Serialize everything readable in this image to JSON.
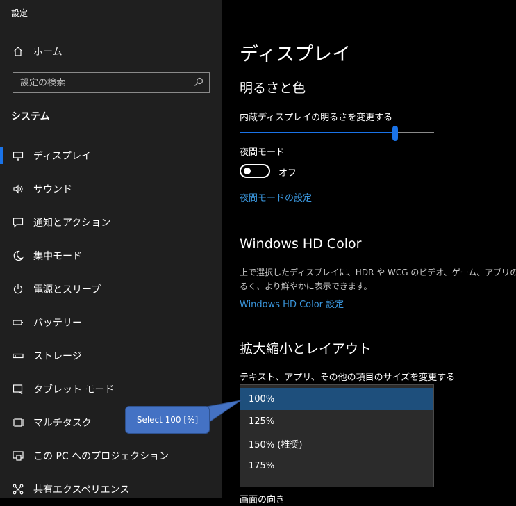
{
  "app": {
    "title": "設定"
  },
  "sidebar": {
    "home_label": "ホーム",
    "search_placeholder": "設定の検索",
    "section": "システム",
    "items": [
      {
        "label": "ディスプレイ",
        "icon": "monitor-icon",
        "active": true
      },
      {
        "label": "サウンド",
        "icon": "speaker-icon"
      },
      {
        "label": "通知とアクション",
        "icon": "notification-icon"
      },
      {
        "label": "集中モード",
        "icon": "moon-icon"
      },
      {
        "label": "電源とスリープ",
        "icon": "power-icon"
      },
      {
        "label": "バッテリー",
        "icon": "battery-icon"
      },
      {
        "label": "ストレージ",
        "icon": "storage-icon"
      },
      {
        "label": "タブレット モード",
        "icon": "tablet-icon"
      },
      {
        "label": "マルチタスク",
        "icon": "multitask-icon"
      },
      {
        "label": "この PC へのプロジェクション",
        "icon": "projection-icon"
      },
      {
        "label": "共有エクスペリエンス",
        "icon": "share-icon"
      }
    ]
  },
  "main": {
    "title": "ディスプレイ",
    "brightness_section": "明るさと色",
    "brightness_label": "内蔵ディスプレイの明るさを変更する",
    "brightness_value": 0.8,
    "night_mode_label": "夜間モード",
    "night_mode_state": "オフ",
    "night_mode_link": "夜間モードの設定",
    "hdr_section": "Windows HD Color",
    "hdr_desc_1": "上で選択したディスプレイに、HDR や WCG のビデオ、ゲーム、アプリの画像を",
    "hdr_desc_2": "るく、より鮮やかに表示できます。",
    "hdr_link": "Windows HD Color 設定",
    "scale_section": "拡大縮小とレイアウト",
    "scale_label": "テキスト、アプリ、その他の項目のサイズを変更する",
    "scale_options": [
      "100%",
      "125%",
      "150% (推奨)",
      "175%"
    ],
    "scale_selected": "100%",
    "cut_off_text": "画面の向き"
  },
  "annotation": {
    "text": "Select 100 [%]"
  },
  "colors": {
    "accent": "#1a73e8",
    "link": "#3a96dd",
    "selected_option": "#1e4f7c",
    "callout": "#4472c4"
  }
}
